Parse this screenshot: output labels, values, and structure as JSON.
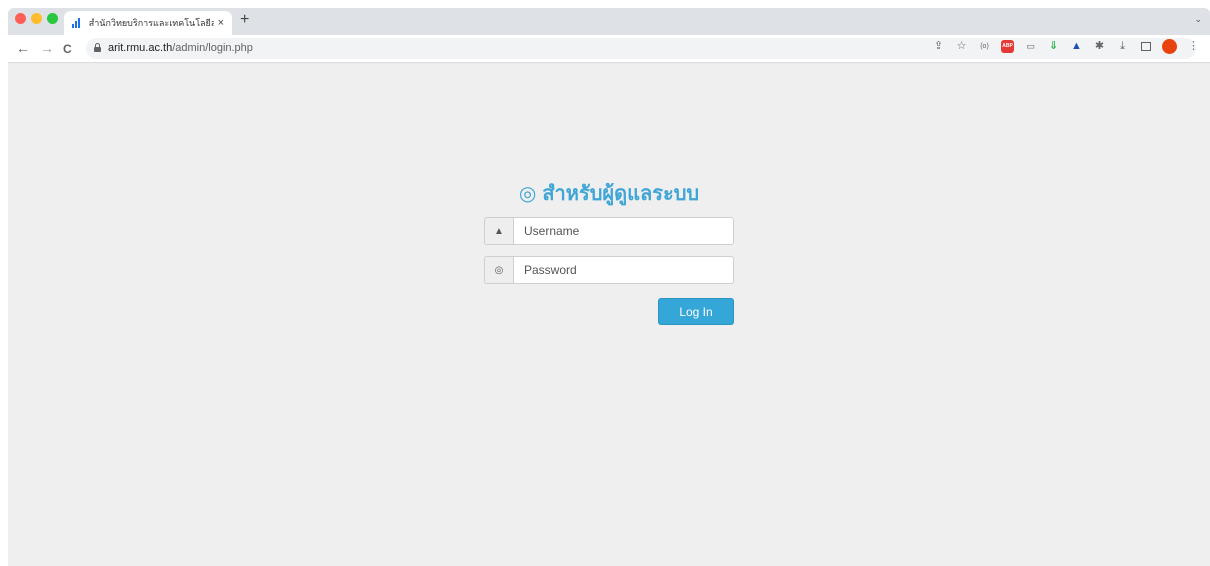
{
  "browser": {
    "tab": {
      "title": "สำนักวิทยบริการและเทคโนโลยีสารสนเทศ",
      "close_icon": "×"
    },
    "new_tab_icon": "+",
    "tab_menu_icon": "⌄",
    "toolbar": {
      "back_icon": "←",
      "forward_icon": "→",
      "reload_icon": "C",
      "url_host": "arit.rmu.ac.th",
      "url_path": "/admin/login.php",
      "icons": [
        "share-icon",
        "bookmark-star-icon",
        "extension-icon",
        "adblock-icon",
        "extension-icon",
        "download-arrow-icon",
        "extension-icon",
        "puzzle-icon",
        "download-icon",
        "sidepanel-icon",
        "profile-avatar-icon",
        "more-menu-icon"
      ]
    }
  },
  "login": {
    "heading": "สำหรับผู้ดูแลระบบ",
    "heading_icon": "◎",
    "username_placeholder": "Username",
    "password_placeholder": "Password",
    "submit_label": "Log In"
  },
  "colors": {
    "accent": "#3fa6d6",
    "button": "#34a6d8"
  }
}
